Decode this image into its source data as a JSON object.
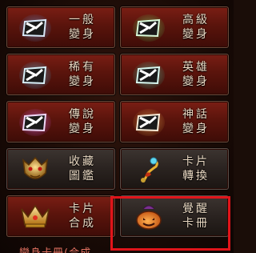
{
  "menu": {
    "buttons": [
      {
        "key": "general",
        "line1": "一般",
        "line2": "變身",
        "icon": "envelope-mask-icon",
        "glow": "#3a7fd0",
        "style": "red"
      },
      {
        "key": "advanced",
        "line1": "高級",
        "line2": "變身",
        "icon": "envelope-mask-icon",
        "glow": "#3fd04a",
        "style": "red"
      },
      {
        "key": "rare",
        "line1": "稀有",
        "line2": "變身",
        "icon": "envelope-mask-icon",
        "glow": "#2fa8e0",
        "style": "red"
      },
      {
        "key": "hero",
        "line1": "英雄",
        "line2": "變身",
        "icon": "envelope-mask-icon",
        "glow": "#1fc09a",
        "style": "red"
      },
      {
        "key": "legend",
        "line1": "傳說",
        "line2": "變身",
        "icon": "envelope-mask-icon",
        "glow": "#c040d0",
        "style": "red"
      },
      {
        "key": "myth",
        "line1": "神話",
        "line2": "變身",
        "icon": "envelope-mask-icon",
        "glow": "#e09a30",
        "style": "red"
      },
      {
        "key": "collection",
        "line1": "收藏",
        "line2": "圖鑑",
        "icon": "golden-demon-mask-icon",
        "glow": "#d8a030",
        "style": "dark"
      },
      {
        "key": "exchange",
        "line1": "卡片",
        "line2": "轉換",
        "icon": "magic-wand-icon",
        "glow": "#40c0e0",
        "style": "dark"
      },
      {
        "key": "compose",
        "line1": "卡片",
        "line2": "合成",
        "icon": "golden-crown-icon",
        "glow": "#e0b040",
        "style": "red"
      },
      {
        "key": "awaken",
        "line1": "覺醒",
        "line2": "卡冊",
        "icon": "pumpkin-icon",
        "glow": "#e07020",
        "style": "dark"
      }
    ]
  },
  "footer": {
    "text": "變身卡冊(合成"
  },
  "colors": {
    "highlight": "#e0141a",
    "label": "#e9d8c2"
  }
}
